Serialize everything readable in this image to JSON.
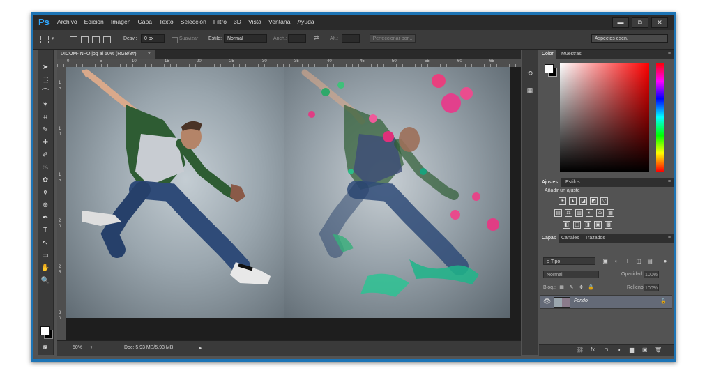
{
  "app": {
    "logo": "Ps"
  },
  "menu": [
    "Archivo",
    "Edición",
    "Imagen",
    "Capa",
    "Texto",
    "Selección",
    "Filtro",
    "3D",
    "Vista",
    "Ventana",
    "Ayuda"
  ],
  "window_buttons": [
    "▬",
    "⧉",
    "✕"
  ],
  "options": {
    "feather_label": "Desv.:",
    "feather_value": "0 px",
    "smooth_label": "Suavizar",
    "style_label": "Estilo:",
    "style_value": "Normal",
    "width_label": "Anch.:",
    "height_label": "Alt.:",
    "refine_button": "Perfeccionar bor...",
    "workspace": "Aspectos esen."
  },
  "document": {
    "tab_title": "DICOM-INFO.jpg al 50% (RGB/8#)",
    "tab_close": "×",
    "ruler_h": [
      "0",
      "5",
      "10",
      "15",
      "20",
      "25",
      "30",
      "35",
      "40",
      "45",
      "50",
      "55",
      "60",
      "65"
    ],
    "ruler_v": [
      "1",
      "5",
      "1",
      "0",
      "1",
      "5",
      "2",
      "0",
      "2",
      "5",
      "3",
      "0"
    ],
    "zoom": "50%",
    "doc_info": "Doc: 5,93 MB/5,93 MB"
  },
  "tools": [
    "➤",
    "⬚",
    "⌒",
    "✶",
    "⌗",
    "✎",
    "✚",
    "✐",
    "♨",
    "✿",
    "⚱",
    "⊕",
    "✒",
    "T",
    "↖",
    "▭",
    "✋",
    "🔍"
  ],
  "color_panel": {
    "tabs": [
      "Color",
      "Muestras"
    ],
    "fg": "#ffffff",
    "bg": "#000000",
    "hue_color": "#ff0000"
  },
  "adjust_panel": {
    "tabs": [
      "Ajustes",
      "Estilos"
    ],
    "title": "Añadir un ajuste",
    "row1": [
      "☀",
      "▲",
      "◪",
      "◩",
      "▽"
    ],
    "row2": [
      "▤",
      "⚖",
      "▥",
      "◐",
      "♺",
      "▦"
    ],
    "row3": [
      "◧",
      "◫",
      "◨",
      "▣",
      "▩"
    ]
  },
  "layers_panel": {
    "tabs": [
      "Capas",
      "Canales",
      "Trazados"
    ],
    "search": "ρ Tipo",
    "blend_mode": "Normal",
    "opacity_label": "Opacidad:",
    "opacity_value": "100%",
    "lock_label": "Bloq.:",
    "fill_label": "Relleno:",
    "fill_value": "100%",
    "layer_name": "Fondo",
    "footer_icons": [
      "⛓",
      "fx",
      "◘",
      "◑",
      "▆",
      "▣",
      "🗑"
    ]
  }
}
